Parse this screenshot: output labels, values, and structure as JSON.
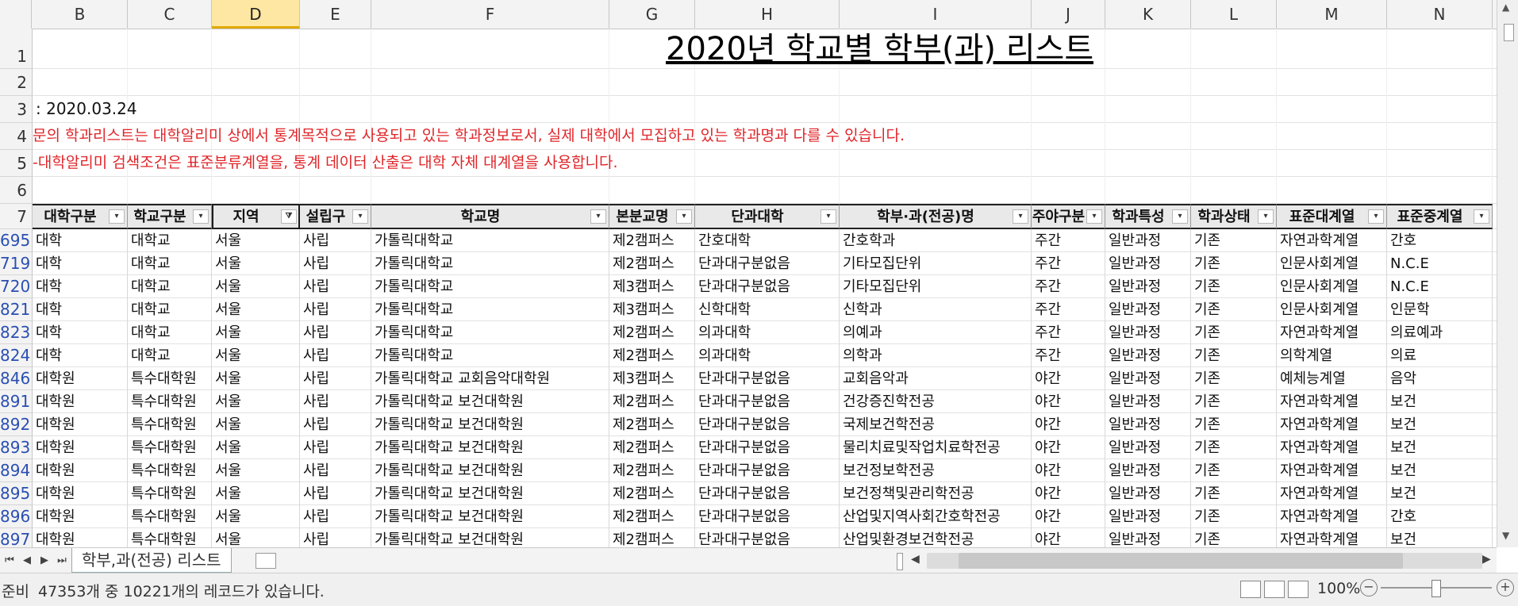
{
  "columns": [
    "B",
    "C",
    "D",
    "E",
    "F",
    "G",
    "H",
    "I",
    "J",
    "K",
    "L",
    "M",
    "N"
  ],
  "rows_top": [
    "1",
    "2",
    "3",
    "4",
    "5",
    "6",
    "7"
  ],
  "title": "2020년 학교별 학부(과) 리스트",
  "date_line": ": 2020.03.24",
  "note1": "문의 학과리스트는 대학알리미 상에서 통계목적으로 사용되고 있는 학과정보로서, 실제 대학에서 모집하고 있는 학과명과 다를 수 있습니다.",
  "note2": "-대학알리미 검색조건은 표준분류계열을, 통계 데이터 산출은 대학 자체 대계열을 사용합니다.",
  "headers": [
    "대학구분",
    "학교구분",
    "지역",
    "설립구",
    "학교명",
    "본분교명",
    "단과대학",
    "학부·과(전공)명",
    "주야구분",
    "학과특성",
    "학과상태",
    "표준대계열",
    "표준중계열"
  ],
  "rows": [
    {
      "n": "695",
      "c": [
        "대학",
        "대학교",
        "서울",
        "사립",
        "가톨릭대학교",
        "제2캠퍼스",
        "간호대학",
        "간호학과",
        "주간",
        "일반과정",
        "기존",
        "자연과학계열",
        "간호"
      ]
    },
    {
      "n": "719",
      "c": [
        "대학",
        "대학교",
        "서울",
        "사립",
        "가톨릭대학교",
        "제2캠퍼스",
        "단과대구분없음",
        "기타모집단위",
        "주간",
        "일반과정",
        "기존",
        "인문사회계열",
        "N.C.E"
      ]
    },
    {
      "n": "720",
      "c": [
        "대학",
        "대학교",
        "서울",
        "사립",
        "가톨릭대학교",
        "제3캠퍼스",
        "단과대구분없음",
        "기타모집단위",
        "주간",
        "일반과정",
        "기존",
        "인문사회계열",
        "N.C.E"
      ]
    },
    {
      "n": "821",
      "c": [
        "대학",
        "대학교",
        "서울",
        "사립",
        "가톨릭대학교",
        "제3캠퍼스",
        "신학대학",
        "신학과",
        "주간",
        "일반과정",
        "기존",
        "인문사회계열",
        "인문학"
      ]
    },
    {
      "n": "823",
      "c": [
        "대학",
        "대학교",
        "서울",
        "사립",
        "가톨릭대학교",
        "제2캠퍼스",
        "의과대학",
        "의예과",
        "주간",
        "일반과정",
        "기존",
        "자연과학계열",
        "의료예과"
      ]
    },
    {
      "n": "824",
      "c": [
        "대학",
        "대학교",
        "서울",
        "사립",
        "가톨릭대학교",
        "제2캠퍼스",
        "의과대학",
        "의학과",
        "주간",
        "일반과정",
        "기존",
        "의학계열",
        "의료"
      ]
    },
    {
      "n": "846",
      "c": [
        "대학원",
        "특수대학원",
        "서울",
        "사립",
        "가톨릭대학교 교회음악대학원",
        "제3캠퍼스",
        "단과대구분없음",
        "교회음악과",
        "야간",
        "일반과정",
        "기존",
        "예체능계열",
        "음악"
      ]
    },
    {
      "n": "891",
      "c": [
        "대학원",
        "특수대학원",
        "서울",
        "사립",
        "가톨릭대학교 보건대학원",
        "제2캠퍼스",
        "단과대구분없음",
        "건강증진학전공",
        "야간",
        "일반과정",
        "기존",
        "자연과학계열",
        "보건"
      ]
    },
    {
      "n": "892",
      "c": [
        "대학원",
        "특수대학원",
        "서울",
        "사립",
        "가톨릭대학교 보건대학원",
        "제2캠퍼스",
        "단과대구분없음",
        "국제보건학전공",
        "야간",
        "일반과정",
        "기존",
        "자연과학계열",
        "보건"
      ]
    },
    {
      "n": "893",
      "c": [
        "대학원",
        "특수대학원",
        "서울",
        "사립",
        "가톨릭대학교 보건대학원",
        "제2캠퍼스",
        "단과대구분없음",
        "물리치료및작업치료학전공",
        "야간",
        "일반과정",
        "기존",
        "자연과학계열",
        "보건"
      ]
    },
    {
      "n": "894",
      "c": [
        "대학원",
        "특수대학원",
        "서울",
        "사립",
        "가톨릭대학교 보건대학원",
        "제2캠퍼스",
        "단과대구분없음",
        "보건정보학전공",
        "야간",
        "일반과정",
        "기존",
        "자연과학계열",
        "보건"
      ]
    },
    {
      "n": "895",
      "c": [
        "대학원",
        "특수대학원",
        "서울",
        "사립",
        "가톨릭대학교 보건대학원",
        "제2캠퍼스",
        "단과대구분없음",
        "보건정책및관리학전공",
        "야간",
        "일반과정",
        "기존",
        "자연과학계열",
        "보건"
      ]
    },
    {
      "n": "896",
      "c": [
        "대학원",
        "특수대학원",
        "서울",
        "사립",
        "가톨릭대학교 보건대학원",
        "제2캠퍼스",
        "단과대구분없음",
        "산업및지역사회간호학전공",
        "야간",
        "일반과정",
        "기존",
        "자연과학계열",
        "간호"
      ]
    },
    {
      "n": "897",
      "c": [
        "대학원",
        "특수대학원",
        "서울",
        "사립",
        "가톨릭대학교 보건대학원",
        "제2캠퍼스",
        "단과대구분없음",
        "산업및환경보건학전공",
        "야간",
        "일반과정",
        "기존",
        "자연과학계열",
        "보건"
      ]
    }
  ],
  "sheet_tab": "학부,과(전공) 리스트",
  "status_ready": "준비",
  "status_records": "47353개 중 10221개의 레코드가 있습니다.",
  "zoom": "100%"
}
